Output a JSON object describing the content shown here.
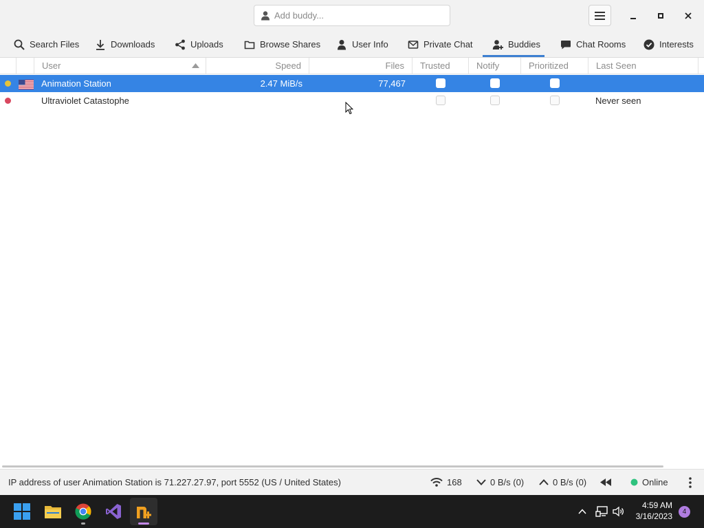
{
  "header": {
    "add_buddy_placeholder": "Add buddy..."
  },
  "tabs": [
    {
      "label": "Search Files"
    },
    {
      "label": "Downloads"
    },
    {
      "label": "Uploads"
    },
    {
      "label": "Browse Shares"
    },
    {
      "label": "User Info"
    },
    {
      "label": "Private Chat"
    },
    {
      "label": "Buddies",
      "active": true
    },
    {
      "label": "Chat Rooms"
    },
    {
      "label": "Interests"
    }
  ],
  "columns": {
    "user": "User",
    "speed": "Speed",
    "files": "Files",
    "trusted": "Trusted",
    "notify": "Notify",
    "prioritized": "Prioritized",
    "last_seen": "Last Seen"
  },
  "buddies": [
    {
      "status_color": "#e5c33a",
      "flag": "US",
      "user": "Animation Station",
      "speed": "2.47 MiB/s",
      "files": "77,467",
      "trusted": false,
      "notify": false,
      "prioritized": false,
      "last_seen": "",
      "selected": true
    },
    {
      "status_color": "#d9485f",
      "flag": "",
      "user": "Ultraviolet Catastophe",
      "speed": "",
      "files": "",
      "trusted": false,
      "notify": false,
      "prioritized": false,
      "last_seen": "Never seen",
      "selected": false
    }
  ],
  "statusbar": {
    "message": "IP address of user Animation Station is 71.227.27.97, port 5552 (US / United States)",
    "connections": "168",
    "download_rate": "0 B/s (0)",
    "upload_rate": "0 B/s (0)",
    "online_status": "Online",
    "online_color": "#2ec27e"
  },
  "taskbar": {
    "time": "4:59 AM",
    "date": "3/16/2023",
    "notification_count": "4",
    "apps": [
      "start-icon",
      "file-explorer-icon",
      "chrome-icon",
      "visual-studio-icon",
      "nicotine-plus-icon"
    ]
  },
  "colors": {
    "accent": "#3584e4",
    "tab_underline": "#3d7fd1"
  }
}
